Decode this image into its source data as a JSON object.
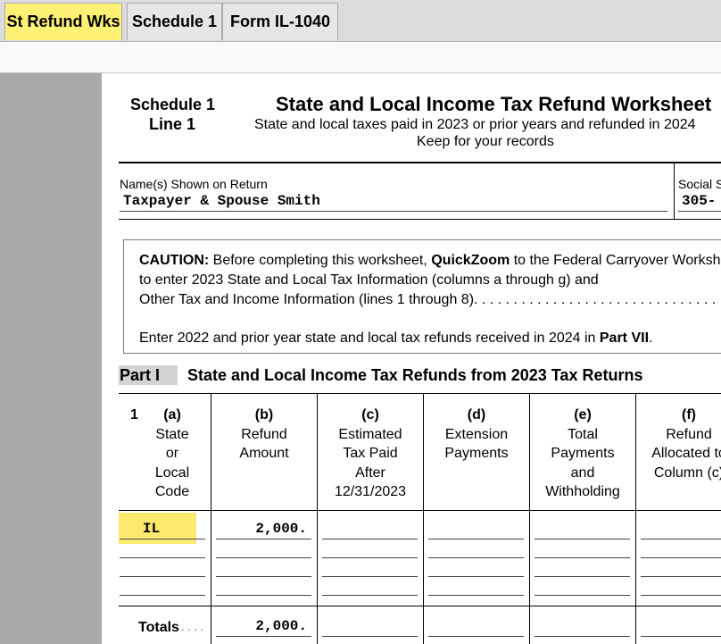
{
  "tabs": [
    {
      "label": "St Refund Wks"
    },
    {
      "label": "Schedule 1"
    },
    {
      "label": "Form IL-1040"
    }
  ],
  "header": {
    "schedule": "Schedule 1",
    "line": "Line 1",
    "title": "State and Local Income Tax Refund Worksheet",
    "subtitle": "State and local taxes paid in 2023 or prior years and refunded in 2024",
    "keep": "Keep for your records"
  },
  "name_row": {
    "name_label": "Name(s) Shown on Return",
    "name_value": "Taxpayer & Spouse Smith",
    "ssn_label": "Social Security Number",
    "ssn_value": "305-"
  },
  "caution": {
    "prefix": "CAUTION:",
    "line1_a": " Before completing this worksheet, ",
    "line1_bold": "QuickZoom",
    "line1_b": " to the Federal Carryover Worksheet",
    "line2": "to enter 2023 State and Local Tax Information (columns a through g) and",
    "line3": "Other Tax and Income Information (lines 1 through 8). . . . . . . . . . . . . . . . . . . . . . . . . . . . . . . . . . . . . . . . . .",
    "line4_a": "Enter 2022 and prior year state and local tax refunds received in 2024 in ",
    "line4_bold": "Part VII",
    "line4_b": "."
  },
  "part1": {
    "label": "Part I",
    "title": "State and Local Income Tax Refunds from 2023 Tax Returns"
  },
  "table": {
    "line_number": "1",
    "columns": [
      {
        "letter": "(a)",
        "lines": [
          "State",
          "or",
          "Local",
          "Code"
        ]
      },
      {
        "letter": "(b)",
        "lines": [
          "Refund",
          "Amount"
        ]
      },
      {
        "letter": "(c)",
        "lines": [
          "Estimated",
          "Tax Paid",
          "After",
          "12/31/2023"
        ]
      },
      {
        "letter": "(d)",
        "lines": [
          "Extension",
          "Payments"
        ]
      },
      {
        "letter": "(e)",
        "lines": [
          "Total",
          "Payments",
          "and",
          "Withholding"
        ]
      },
      {
        "letter": "(f)",
        "lines": [
          "Refund",
          "Allocated to",
          "Column (c)"
        ]
      }
    ],
    "rows": [
      {
        "state": "IL",
        "refund": "2,000."
      }
    ],
    "totals_label": "Totals",
    "totals_dots": ". . . .",
    "totals_refund": "2,000."
  },
  "colors": {
    "active_tab": "#fff176",
    "highlight": "#ffe86e",
    "sidebar": "#a9a9a9",
    "part_label_bg": "#d3d3d3"
  }
}
